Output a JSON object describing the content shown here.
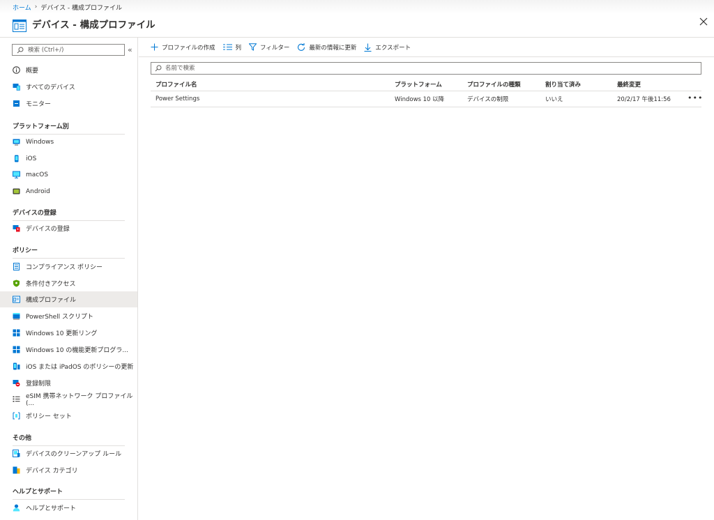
{
  "breadcrumb": {
    "home": "ホーム",
    "separator": "›",
    "current": "デバイス - 構成プロファイル"
  },
  "title": "デバイス - 構成プロファイル",
  "sidebar": {
    "search_placeholder": "検索 (Ctrl+/)",
    "collapse": "«",
    "top_items": [
      {
        "label": "概要",
        "icon": "info-icon"
      },
      {
        "label": "すべてのデバイス",
        "icon": "devices-icon"
      },
      {
        "label": "モニター",
        "icon": "monitor-icon"
      }
    ],
    "sections": [
      {
        "title": "プラットフォーム別",
        "items": [
          {
            "label": "Windows",
            "icon": "windows-device-icon"
          },
          {
            "label": "iOS",
            "icon": "ios-device-icon"
          },
          {
            "label": "macOS",
            "icon": "macos-device-icon"
          },
          {
            "label": "Android",
            "icon": "android-device-icon"
          }
        ]
      },
      {
        "title": "デバイスの登録",
        "items": [
          {
            "label": "デバイスの登録",
            "icon": "enroll-icon"
          }
        ]
      },
      {
        "title": "ポリシー",
        "items": [
          {
            "label": "コンプライアンス ポリシー",
            "icon": "compliance-icon"
          },
          {
            "label": "条件付きアクセス",
            "icon": "shield-icon"
          },
          {
            "label": "構成プロファイル",
            "icon": "config-profile-icon",
            "active": true
          },
          {
            "label": "PowerShell スクリプト",
            "icon": "powershell-icon"
          },
          {
            "label": "Windows 10 更新リング",
            "icon": "windows-logo-icon"
          },
          {
            "label": "Windows 10 の機能更新プログラ...",
            "icon": "windows-logo-icon"
          },
          {
            "label": "iOS または iPadOS のポリシーの更新",
            "icon": "ios-update-icon"
          },
          {
            "label": "登録制限",
            "icon": "enroll-restriction-icon"
          },
          {
            "label": "eSIM 携帯ネットワーク プロファイル (...",
            "icon": "list-icon"
          },
          {
            "label": "ポリシー セット",
            "icon": "policy-set-icon"
          }
        ]
      },
      {
        "title": "その他",
        "items": [
          {
            "label": "デバイスのクリーンアップ ルール",
            "icon": "cleanup-icon"
          },
          {
            "label": "デバイス カテゴリ",
            "icon": "category-icon"
          }
        ]
      },
      {
        "title": "ヘルプとサポート",
        "items": [
          {
            "label": "ヘルプとサポート",
            "icon": "person-help-icon"
          }
        ]
      }
    ]
  },
  "toolbar": {
    "create": "プロファイルの作成",
    "columns": "列",
    "filter": "フィルター",
    "refresh": "最新の情報に更新",
    "export": "エクスポート"
  },
  "filter_placeholder": "名前で検索",
  "table": {
    "columns": [
      "プロファイル名",
      "プラットフォーム",
      "プロファイルの種類",
      "割り当て済み",
      "最終変更"
    ],
    "rows": [
      {
        "name": "Power Settings",
        "platform": "Windows 10 以降",
        "type": "デバイスの制限",
        "assigned": "いいえ",
        "modified": "20/2/17 午後11:56",
        "more": "•••"
      }
    ]
  },
  "colors": {
    "accent": "#0078d4",
    "border": "#e1dfdd",
    "active_bg": "#edebe9"
  }
}
